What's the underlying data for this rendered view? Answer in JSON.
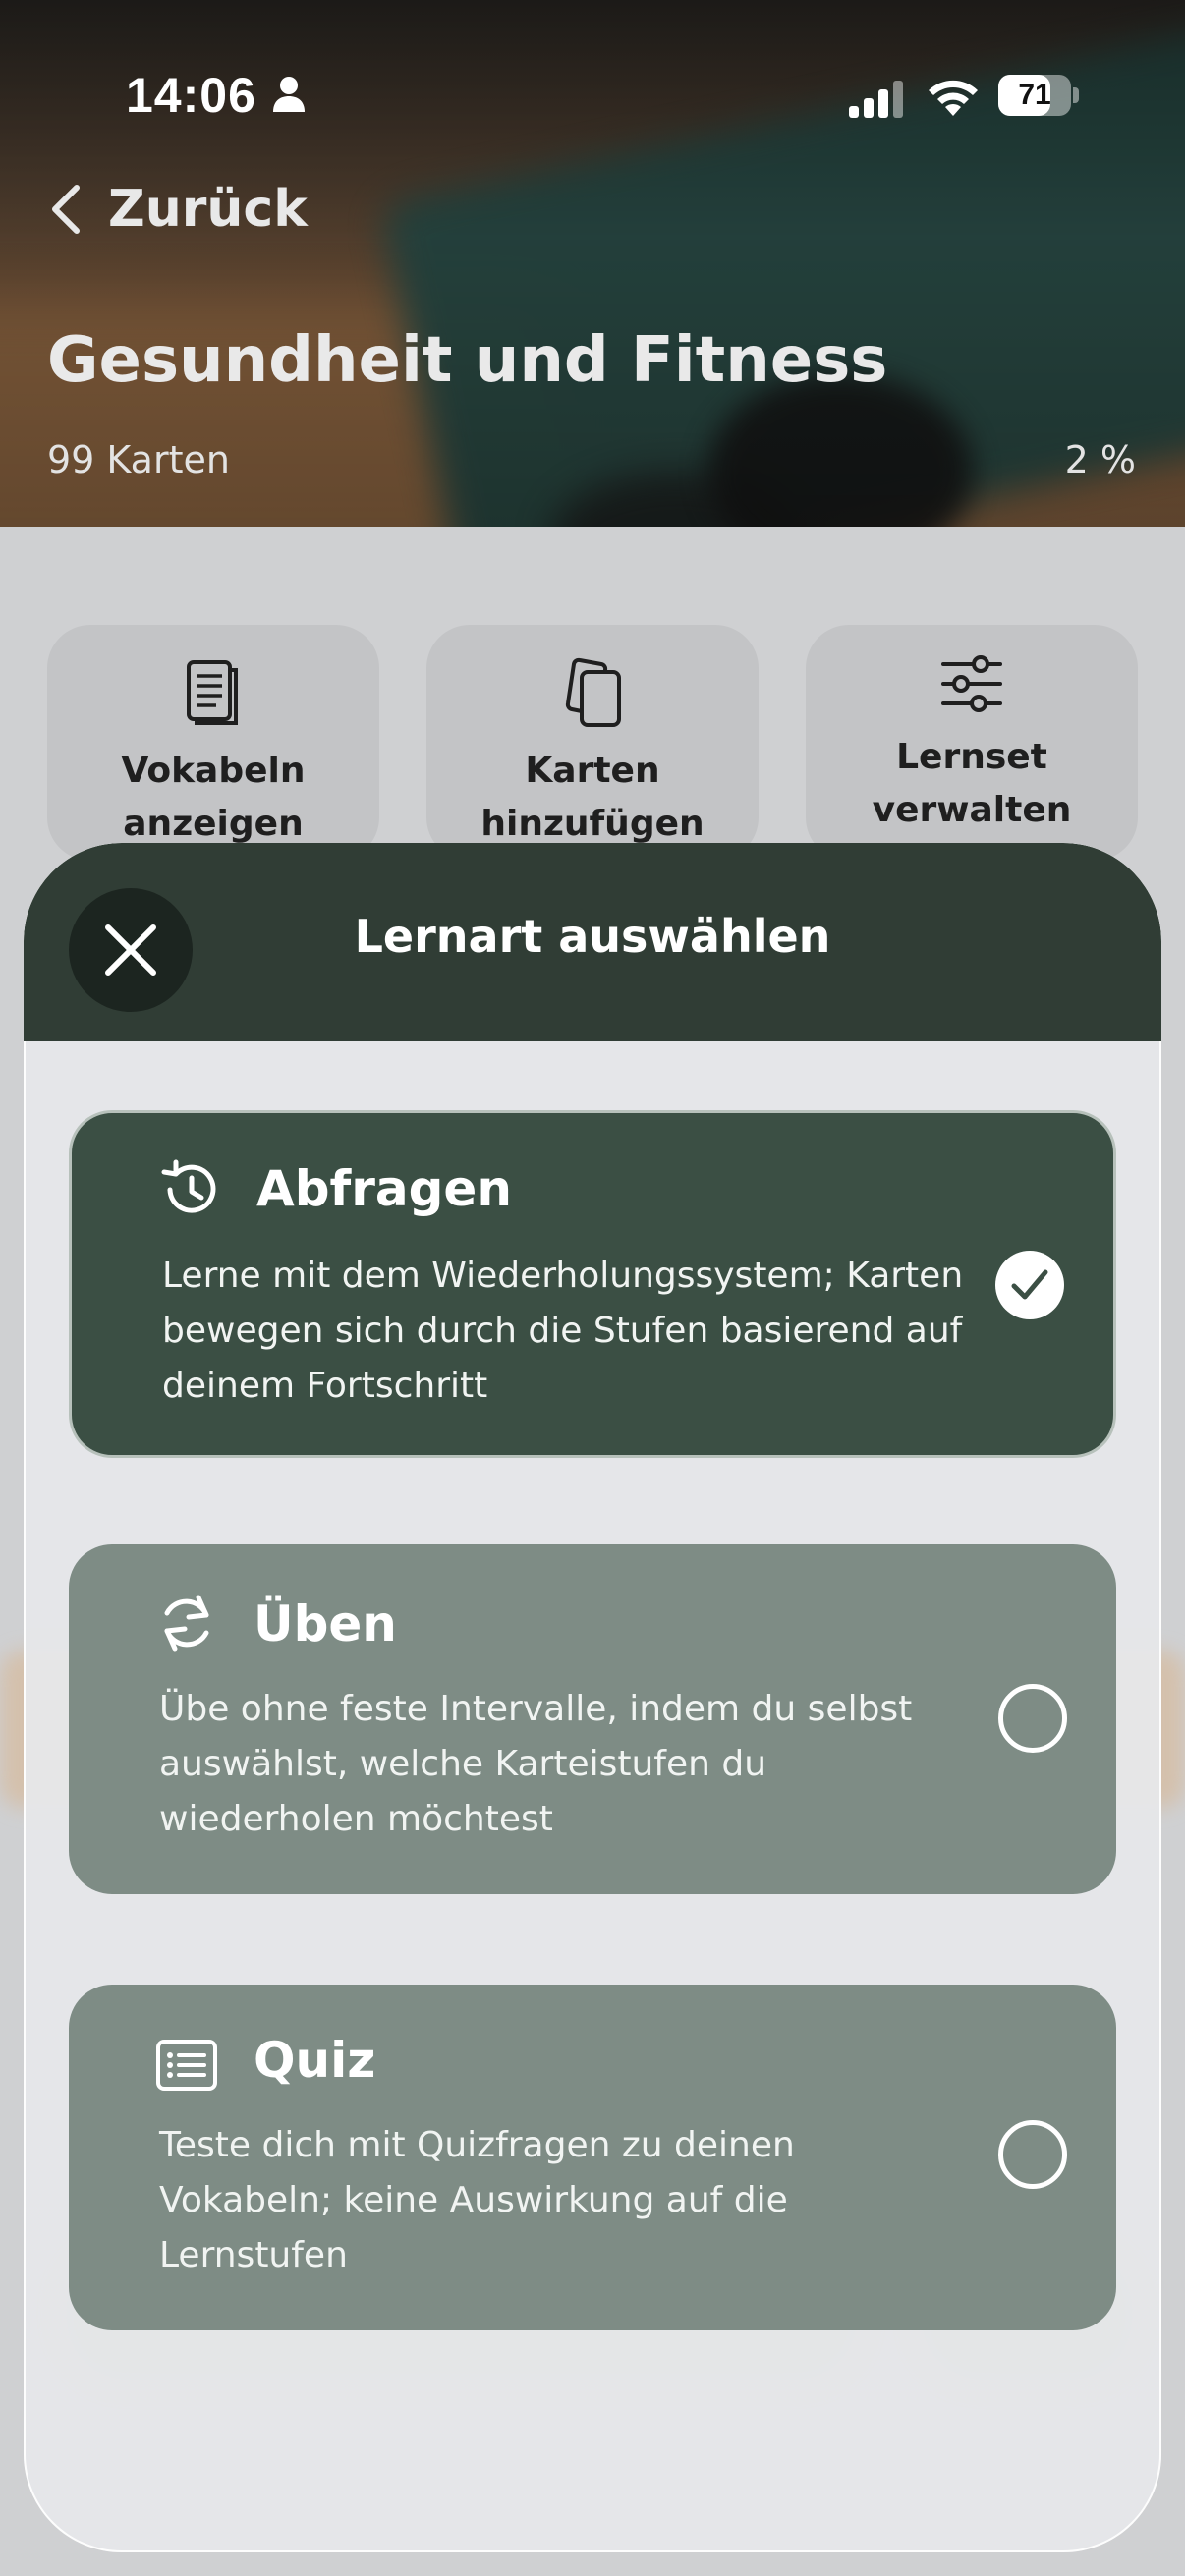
{
  "status_bar": {
    "time": "14:06",
    "battery_percent": "71",
    "battery_level": 0.71
  },
  "header": {
    "back_label": "Zurück",
    "title": "Gesundheit und Fitness",
    "card_count": "99 Karten",
    "progress": "2 %"
  },
  "actions": [
    {
      "label": "Vokabeln\nanzeigen",
      "icon": "document-list-icon"
    },
    {
      "label": "Karten\nhinzufügen",
      "icon": "cards-stack-icon"
    },
    {
      "label": "Lernset\nverwalten",
      "icon": "sliders-icon"
    }
  ],
  "sheet": {
    "title": "Lernart auswählen",
    "options": [
      {
        "title": "Abfragen",
        "icon": "history-clock-icon",
        "description": "Lerne mit dem Wiederholungssystem; Karten bewegen sich durch die Stufen basierend auf deinem Fortschritt",
        "selected": true
      },
      {
        "title": "Üben",
        "icon": "refresh-icon",
        "description": "Übe ohne feste Intervalle, indem du selbst auswählst, welche Karteistufen du wiederholen möchtest",
        "selected": false
      },
      {
        "title": "Quiz",
        "icon": "quiz-list-icon",
        "description": "Teste dich mit Quizfragen zu deinen Vokabeln; keine Auswirkung auf die Lernstufen",
        "selected": false
      }
    ]
  },
  "colors": {
    "sheet_header": "#303d35",
    "selected_option": "#3b4f44",
    "unselected_option": "#7e8c85"
  }
}
